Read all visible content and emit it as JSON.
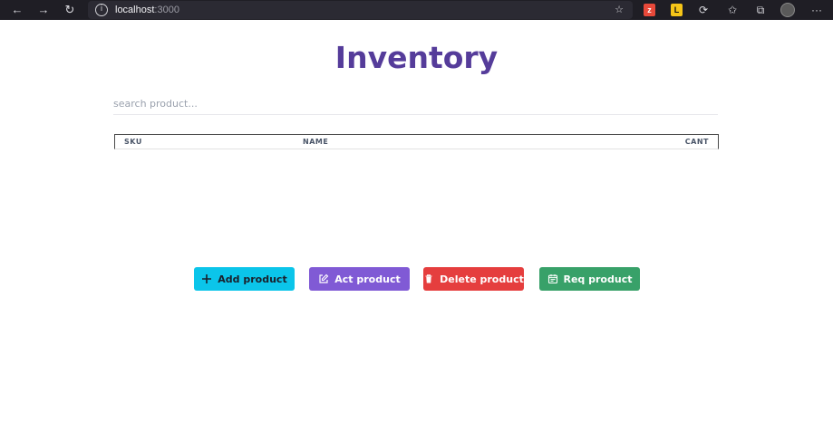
{
  "browser": {
    "url_host": "localhost",
    "url_port": ":3000",
    "ext1_label": "z",
    "ext2_label": "L"
  },
  "page": {
    "title": "Inventory",
    "search_placeholder": "search product...",
    "table": {
      "columns": [
        "SKU",
        "NAME",
        "CANT"
      ],
      "rows": []
    },
    "buttons": {
      "add": "Add product",
      "act": "Act product",
      "delete": "Delete product",
      "req": "Req product"
    }
  },
  "colors": {
    "title": "#553c9a",
    "add": "#0bc5ea",
    "act": "#805ad5",
    "delete": "#e53e3e",
    "req": "#38a169"
  }
}
